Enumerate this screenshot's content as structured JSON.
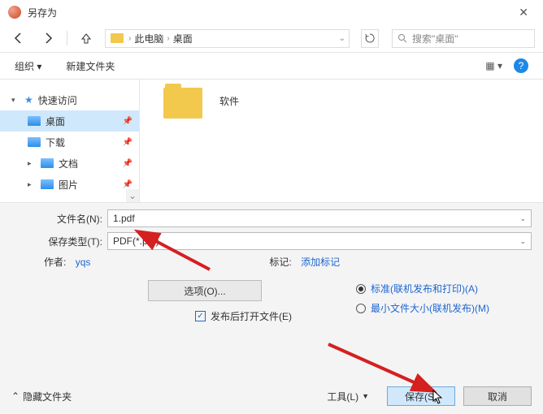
{
  "window": {
    "title": "另存为"
  },
  "nav": {
    "breadcrumb": [
      "此电脑",
      "桌面"
    ],
    "search_placeholder": "搜索\"桌面\""
  },
  "toolbar": {
    "organize": "组织 ▾",
    "new_folder": "新建文件夹"
  },
  "sidebar": {
    "quick_access": "快速访问",
    "items": [
      {
        "label": "桌面"
      },
      {
        "label": "下载"
      },
      {
        "label": "文档"
      },
      {
        "label": "图片"
      }
    ]
  },
  "files": {
    "items": [
      {
        "label": "软件"
      }
    ]
  },
  "form": {
    "filename_label": "文件名(N):",
    "filename_value": "1.pdf",
    "filetype_label": "保存类型(T):",
    "filetype_value": "PDF(*.pdf)",
    "author_label": "作者:",
    "author_value": "yqs",
    "tags_label": "标记:",
    "tags_value": "添加标记",
    "options_button": "选项(O)...",
    "open_after_label": "发布后打开文件(E)",
    "radios": {
      "standard": "标准(联机发布和打印)(A)",
      "min": "最小文件大小(联机发布)(M)"
    }
  },
  "footer": {
    "hide": "隐藏文件夹",
    "tools": "工具(L)",
    "save": "保存(S)",
    "cancel": "取消"
  }
}
